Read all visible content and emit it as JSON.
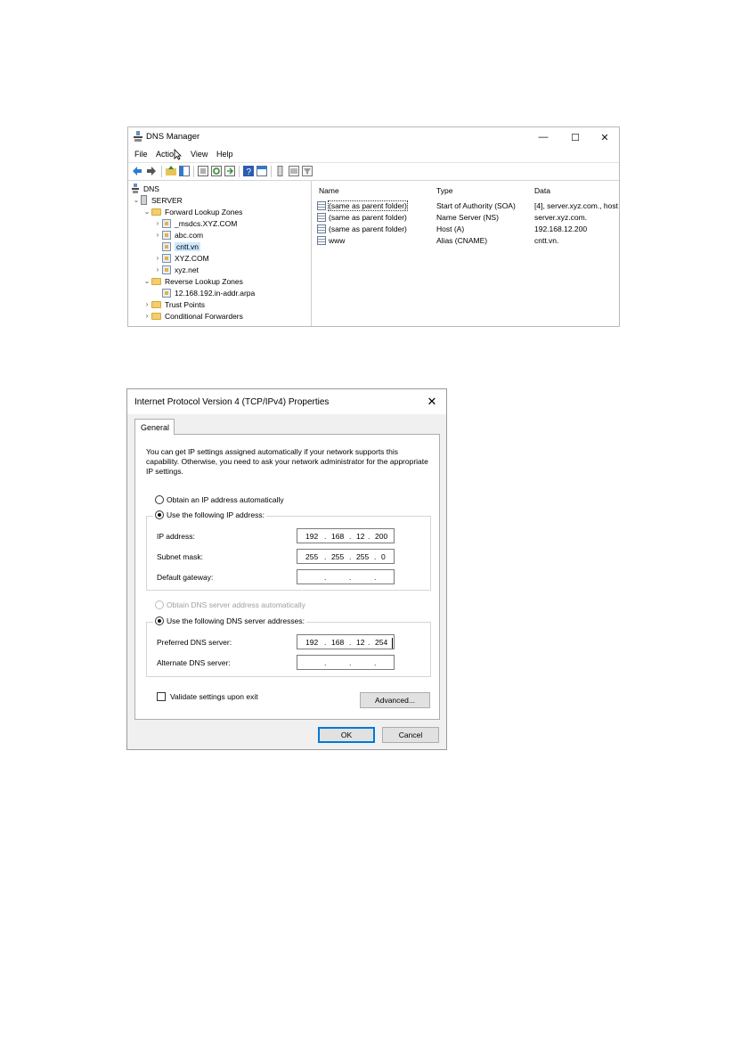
{
  "dns_manager": {
    "title": "DNS Manager",
    "window_controls": {
      "minimize": "—",
      "maximize": "☐",
      "close": "✕"
    },
    "menu": [
      "File",
      "Action",
      "View",
      "Help"
    ],
    "tree": {
      "root": "DNS",
      "server": "SERVER",
      "forward": "Forward Lookup Zones",
      "forward_zones": [
        "_msdcs.XYZ.COM",
        "abc.com",
        "cntt.vn",
        "XYZ.COM",
        "xyz.net"
      ],
      "selected_zone": "cntt.vn",
      "reverse": "Reverse Lookup Zones",
      "reverse_zones": [
        "12.168.192.in-addr.arpa"
      ],
      "trust_points": "Trust Points",
      "conditional_forwarders": "Conditional Forwarders"
    },
    "columns": [
      "Name",
      "Type",
      "Data"
    ],
    "records": [
      {
        "name": "(same as parent folder)",
        "type": "Start of Authority (SOA)",
        "data": "[4], server.xyz.com., host"
      },
      {
        "name": "(same as parent folder)",
        "type": "Name Server (NS)",
        "data": "server.xyz.com."
      },
      {
        "name": "(same as parent folder)",
        "type": "Host (A)",
        "data": "192.168.12.200"
      },
      {
        "name": "www",
        "type": "Alias (CNAME)",
        "data": "cntt.vn."
      }
    ]
  },
  "ipv4_dialog": {
    "title": "Internet Protocol Version 4 (TCP/IPv4) Properties",
    "close": "✕",
    "tab": "General",
    "intro": "You can get IP settings assigned automatically if your network supports this capability. Otherwise, you need to ask your network administrator for the appropriate IP settings.",
    "obtain_ip_auto": "Obtain an IP address automatically",
    "use_following_ip": "Use the following IP address:",
    "ip_label": "IP address:",
    "ip_octets": [
      "192",
      "168",
      "12",
      "200"
    ],
    "subnet_label": "Subnet mask:",
    "subnet_octets": [
      "255",
      "255",
      "255",
      "0"
    ],
    "gateway_label": "Default gateway:",
    "obtain_dns_auto": "Obtain DNS server address automatically",
    "use_following_dns": "Use the following DNS server addresses:",
    "preferred_label": "Preferred DNS server:",
    "preferred_octets": [
      "192",
      "168",
      "12",
      "254"
    ],
    "alternate_label": "Alternate DNS server:",
    "validate_label": "Validate settings upon exit",
    "advanced_button": "Advanced...",
    "ok_button": "OK",
    "cancel_button": "Cancel",
    "ip_mode": "static",
    "dns_mode": "static",
    "validate_checked": false
  }
}
